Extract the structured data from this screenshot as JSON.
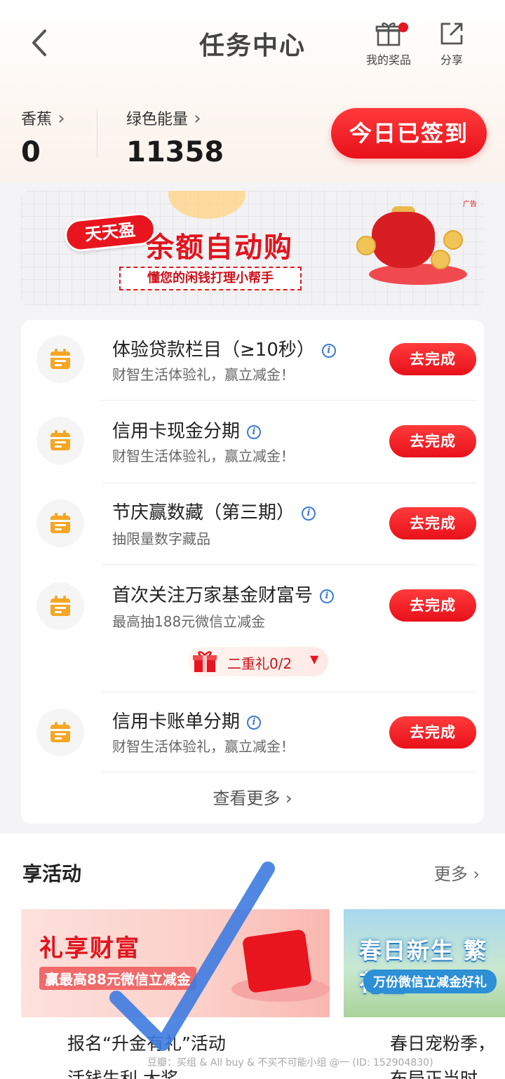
{
  "header": {
    "title": "任务中心",
    "prizes_label": "我的奖品",
    "share_label": "分享"
  },
  "stats": {
    "banana_label": "香蕉",
    "banana_value": "0",
    "energy_label": "绿色能量",
    "energy_value": "11358",
    "signed_label": "今日已签到"
  },
  "banner": {
    "tag": "天天盈",
    "title": "余额自动购",
    "subtitle": "懂您的闲钱打理小帮手",
    "ad_label": "广告"
  },
  "tasks": [
    {
      "title": "体验贷款栏目（≥10秒）",
      "desc": "财智生活体验礼，赢立减金！",
      "button": "去完成"
    },
    {
      "title": "信用卡现金分期",
      "desc": "财智生活体验礼，赢立减金！",
      "button": "去完成"
    },
    {
      "title": "节庆赢数藏（第三期）",
      "desc": "抽限量数字藏品",
      "button": "去完成"
    },
    {
      "title": "首次关注万家基金财富号",
      "desc": "最高抽188元微信立减金",
      "button": "去完成"
    },
    {
      "title": "信用卡账单分期",
      "desc": "财智生活体验礼，赢立减金！",
      "button": "去完成"
    }
  ],
  "bonus": {
    "label": "二重礼0/2"
  },
  "more_tasks": "查看更多",
  "activities": {
    "heading": "享活动",
    "more": "更多",
    "items": [
      {
        "banner_title": "礼享财富",
        "banner_sub": "赢最高88元微信立减金",
        "title_line1": "报名“升金有礼”活动",
        "title_line2": "活钱生利 大奖"
      },
      {
        "banner_title": "春日新生 繁花盛",
        "banner_sub": "万份微信立减金好礼",
        "title_line1": "春日宠粉季，",
        "title_line2": "布局正当时"
      }
    ]
  },
  "watermark": "豆瓣：买组 & All buy & 不买不可能小组 @一 (ID: 152904830)",
  "colors": {
    "accent_red": "#e8151f",
    "icon_orange": "#f5a623",
    "info_blue": "#3a7bd5"
  }
}
